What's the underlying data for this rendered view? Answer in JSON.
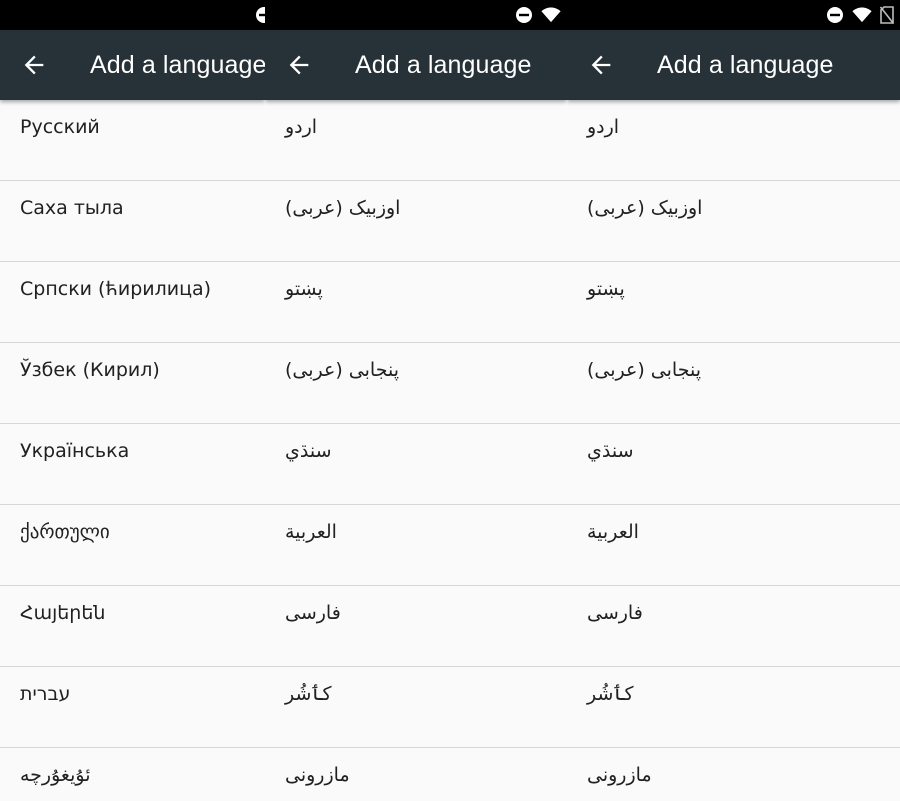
{
  "screens": [
    {
      "title": "Add a language",
      "back_icon": "arrow-back-icon",
      "status_icons": [
        "do-not-disturb-icon"
      ],
      "languages": [
        "Русский",
        "Саха тыла",
        "Српски (ћирилица)",
        "Ўзбек (Кирил)",
        "Українська",
        "ქართული",
        "Հայերեն",
        "עברית",
        "ئۇيغۇرچە"
      ]
    },
    {
      "title": "Add a language",
      "back_icon": "arrow-back-icon",
      "status_icons": [
        "do-not-disturb-icon",
        "wifi-icon"
      ],
      "languages": [
        "اردو",
        "اوزبیک (عربی)",
        "پښتو",
        "پنجابی (عربی)",
        "سنڌي",
        "العربية",
        "فارسی",
        "کٲشُر",
        "مازرونی"
      ]
    },
    {
      "title": "Add a language",
      "back_icon": "arrow-back-icon",
      "status_icons": [
        "do-not-disturb-icon",
        "wifi-icon",
        "no-sim-icon"
      ],
      "languages": [
        "اردو",
        "اوزبیک (عربی)",
        "پښتو",
        "پنجابی (عربی)",
        "سنڌي",
        "العربية",
        "فارسی",
        "کٲشُر",
        "مازرونی"
      ]
    }
  ],
  "colors": {
    "status_bar": "#000000",
    "app_bar": "#263238",
    "title_text": "#ffffff",
    "list_background": "#fafafa",
    "item_text": "#212121",
    "divider": "#d6d6d6"
  }
}
